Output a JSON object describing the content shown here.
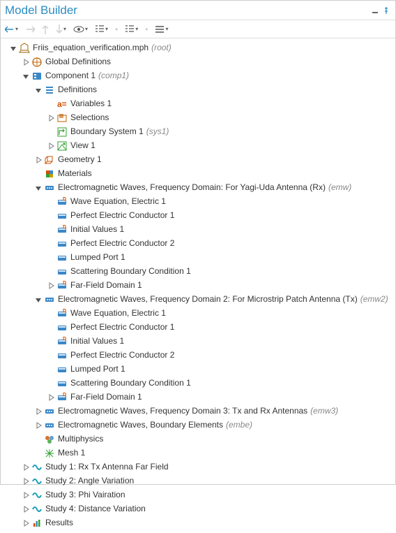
{
  "panel": {
    "title": "Model Builder"
  },
  "tree": [
    {
      "d": 0,
      "e": "open",
      "ic": "root",
      "label": "Friis_equation_verification.mph",
      "ann": "(root)"
    },
    {
      "d": 1,
      "e": "closed",
      "ic": "globe",
      "label": "Global Definitions"
    },
    {
      "d": 1,
      "e": "open",
      "ic": "component",
      "label": "Component 1",
      "ann": "(comp1)"
    },
    {
      "d": 2,
      "e": "open",
      "ic": "defs",
      "label": "Definitions"
    },
    {
      "d": 3,
      "e": "none",
      "ic": "var",
      "label": "Variables 1"
    },
    {
      "d": 3,
      "e": "closed",
      "ic": "sel",
      "label": "Selections"
    },
    {
      "d": 3,
      "e": "none",
      "ic": "bsys",
      "label": "Boundary System 1",
      "ann": "(sys1)"
    },
    {
      "d": 3,
      "e": "closed",
      "ic": "view",
      "label": "View 1"
    },
    {
      "d": 2,
      "e": "closed",
      "ic": "geom",
      "label": "Geometry 1"
    },
    {
      "d": 2,
      "e": "none",
      "ic": "mat",
      "label": "Materials"
    },
    {
      "d": 2,
      "e": "open",
      "ic": "emw",
      "label": "Electromagnetic Waves, Frequency Domain: For Yagi-Uda Antenna (Rx)",
      "ann": "(emw)"
    },
    {
      "d": 3,
      "e": "none",
      "ic": "feat-d",
      "label": "Wave Equation, Electric 1"
    },
    {
      "d": 3,
      "e": "none",
      "ic": "feat",
      "label": "Perfect Electric Conductor 1"
    },
    {
      "d": 3,
      "e": "none",
      "ic": "feat-d",
      "label": "Initial Values 1"
    },
    {
      "d": 3,
      "e": "none",
      "ic": "feat",
      "label": "Perfect Electric Conductor 2"
    },
    {
      "d": 3,
      "e": "none",
      "ic": "feat",
      "label": "Lumped Port 1"
    },
    {
      "d": 3,
      "e": "none",
      "ic": "feat",
      "label": "Scattering Boundary Condition 1"
    },
    {
      "d": 3,
      "e": "closed",
      "ic": "feat-d",
      "label": "Far-Field Domain 1"
    },
    {
      "d": 2,
      "e": "open",
      "ic": "emw",
      "label": "Electromagnetic Waves, Frequency Domain 2: For Microstrip Patch Antenna (Tx)",
      "ann": "(emw2)"
    },
    {
      "d": 3,
      "e": "none",
      "ic": "feat-d",
      "label": "Wave Equation, Electric 1"
    },
    {
      "d": 3,
      "e": "none",
      "ic": "feat",
      "label": "Perfect Electric Conductor 1"
    },
    {
      "d": 3,
      "e": "none",
      "ic": "feat-d",
      "label": "Initial Values 1"
    },
    {
      "d": 3,
      "e": "none",
      "ic": "feat",
      "label": "Perfect Electric Conductor 2"
    },
    {
      "d": 3,
      "e": "none",
      "ic": "feat",
      "label": "Lumped Port 1"
    },
    {
      "d": 3,
      "e": "none",
      "ic": "feat",
      "label": "Scattering Boundary Condition 1"
    },
    {
      "d": 3,
      "e": "closed",
      "ic": "feat-d",
      "label": "Far-Field Domain 1"
    },
    {
      "d": 2,
      "e": "closed",
      "ic": "emw",
      "label": "Electromagnetic Waves, Frequency Domain 3: Tx and Rx Antennas",
      "ann": "(emw3)"
    },
    {
      "d": 2,
      "e": "closed",
      "ic": "emw",
      "label": "Electromagnetic Waves, Boundary Elements",
      "ann": "(embe)"
    },
    {
      "d": 2,
      "e": "none",
      "ic": "multi",
      "label": "Multiphysics"
    },
    {
      "d": 2,
      "e": "none",
      "ic": "mesh",
      "label": "Mesh 1"
    },
    {
      "d": 1,
      "e": "closed",
      "ic": "study",
      "label": "Study 1: Rx Tx Antenna Far Field"
    },
    {
      "d": 1,
      "e": "closed",
      "ic": "study",
      "label": "Study 2: Angle Variation"
    },
    {
      "d": 1,
      "e": "closed",
      "ic": "study",
      "label": "Study 3: Phi Vairation"
    },
    {
      "d": 1,
      "e": "closed",
      "ic": "study",
      "label": "Study 4: Distance Variation"
    },
    {
      "d": 1,
      "e": "closed",
      "ic": "results",
      "label": "Results"
    }
  ]
}
